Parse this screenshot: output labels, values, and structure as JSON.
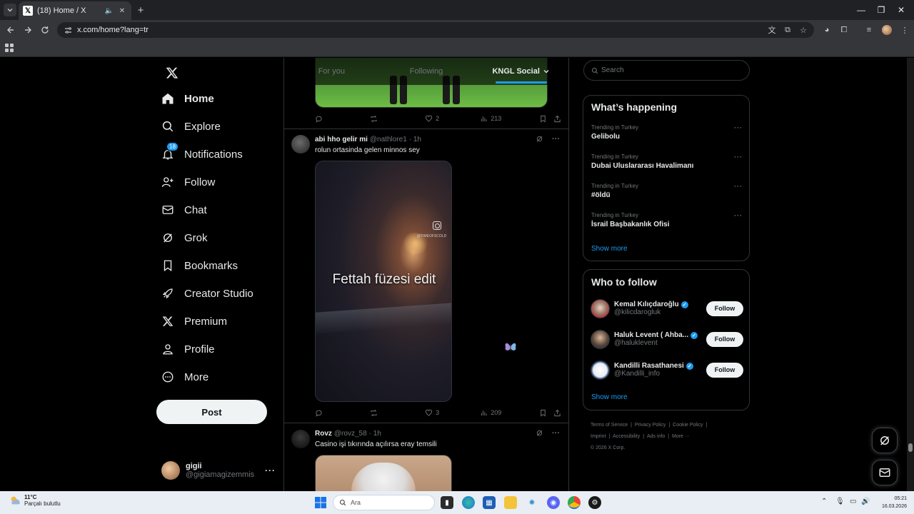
{
  "browser": {
    "tab_title": "(18) Home / X",
    "url": "x.com/home?lang=tr"
  },
  "nav": {
    "items": [
      {
        "label": "Home",
        "icon": "home-icon"
      },
      {
        "label": "Explore",
        "icon": "search-icon"
      },
      {
        "label": "Notifications",
        "icon": "bell-icon",
        "badge": "18"
      },
      {
        "label": "Follow",
        "icon": "add-person-icon"
      },
      {
        "label": "Chat",
        "icon": "mail-icon"
      },
      {
        "label": "Grok",
        "icon": "grok-icon"
      },
      {
        "label": "Bookmarks",
        "icon": "bookmark-icon"
      },
      {
        "label": "Creator Studio",
        "icon": "rocket-icon"
      },
      {
        "label": "Premium",
        "icon": "x-icon"
      },
      {
        "label": "Profile",
        "icon": "person-icon"
      },
      {
        "label": "More",
        "icon": "more-circle-icon"
      }
    ],
    "post_label": "Post",
    "account": {
      "name": "gigii",
      "handle": "@gigiamagizemmis"
    }
  },
  "timeline": {
    "tabs": [
      "For you",
      "Following",
      "KNGL Social"
    ],
    "active_tab": "KNGL Social",
    "top_post": {
      "likes": "2",
      "views": "213"
    },
    "posts": [
      {
        "name": "abi hho gelir mi",
        "handle": "@nathlore1",
        "time": "· 1h",
        "text": "rolun ortasinda gelen minnos sey",
        "video_caption": "Fettah füzesi edit",
        "video_tag": "@TIMEOFSCOLD",
        "likes": "3",
        "views": "209"
      },
      {
        "name": "Rovz",
        "handle": "@rovz_58",
        "time": "· 1h",
        "text": "Casino işi tıkırında açılırsa eray temsili"
      }
    ]
  },
  "right": {
    "search_placeholder": "Search",
    "happening_title": "What’s happening",
    "trends": [
      {
        "category": "Trending in Turkey",
        "title": "Gelibolu"
      },
      {
        "category": "Trending in Turkey",
        "title": "Dubai Uluslararası Havalimanı"
      },
      {
        "category": "Trending in Turkey",
        "title": "#öldü"
      },
      {
        "category": "Trending in Turkey",
        "title": "İsrail Başbakanlık Ofisi"
      }
    ],
    "show_more": "Show more",
    "who_title": "Who to follow",
    "follow_suggestions": [
      {
        "name": "Kemal Kılıçdaroğlu",
        "handle": "@kilicdarogluk",
        "button": "Follow"
      },
      {
        "name": "Haluk Levent ( Ahba...",
        "handle": "@haluklevent",
        "button": "Follow"
      },
      {
        "name": "Kandilli Rasathanesi",
        "handle": "@Kandilli_info",
        "button": "Follow"
      }
    ],
    "footer_links": [
      "Terms of Service",
      "Privacy Policy",
      "Cookie Policy",
      "Imprint",
      "Accessibility",
      "Ads info",
      "More ···"
    ],
    "copyright": "© 2026 X Corp."
  },
  "taskbar": {
    "temperature": "11°C",
    "weather": "Parçalı bulutlu",
    "search_placeholder": "Ara",
    "time": "05:21",
    "date": "16.03.2026"
  },
  "colors": {
    "accent": "#1d9bf0",
    "background": "#000000",
    "border": "#2f3336",
    "muted": "#71767b"
  }
}
